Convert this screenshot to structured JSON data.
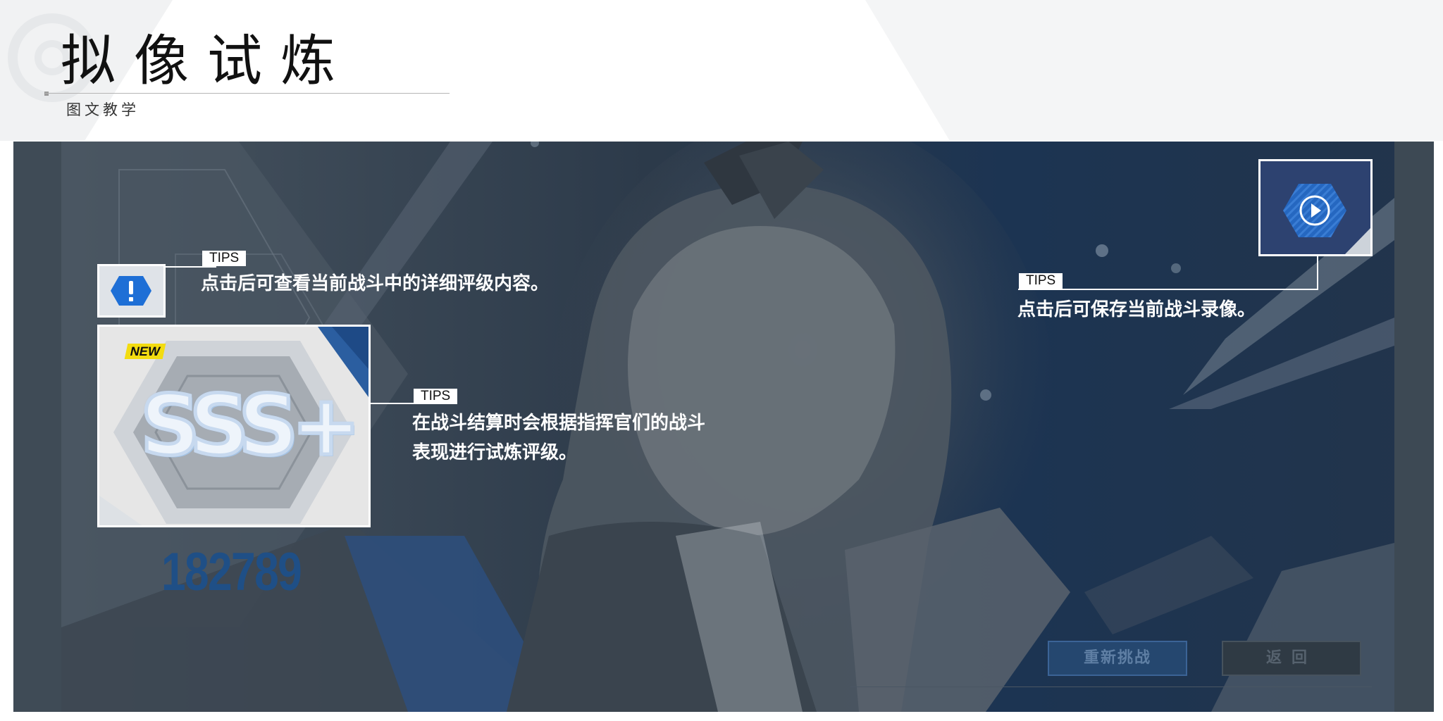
{
  "header": {
    "title": "拟像试炼",
    "subtitle": "图文教学"
  },
  "result": {
    "new_badge": "NEW",
    "rank": "SSS+",
    "score": "182789"
  },
  "tips": [
    {
      "tag": "TIPS",
      "text": "点击后可查看当前战斗中的详细评级内容。"
    },
    {
      "tag": "TIPS",
      "text_line1": "在战斗结算时会根据指挥官们的战斗",
      "text_line2": "表现进行试炼评级。"
    },
    {
      "tag": "TIPS",
      "text": "点击后可保存当前战斗录像。"
    }
  ],
  "buttons": {
    "retry": "重新挑战",
    "back": "返回"
  },
  "colors": {
    "panel_bg": "#1d2a3a",
    "accent_blue": "#1e5ea8",
    "badge_yellow": "#f3dc10",
    "score_blue": "#1f4f86"
  },
  "icons": {
    "detail": "alert-hex-icon",
    "record": "play-hex-icon"
  }
}
